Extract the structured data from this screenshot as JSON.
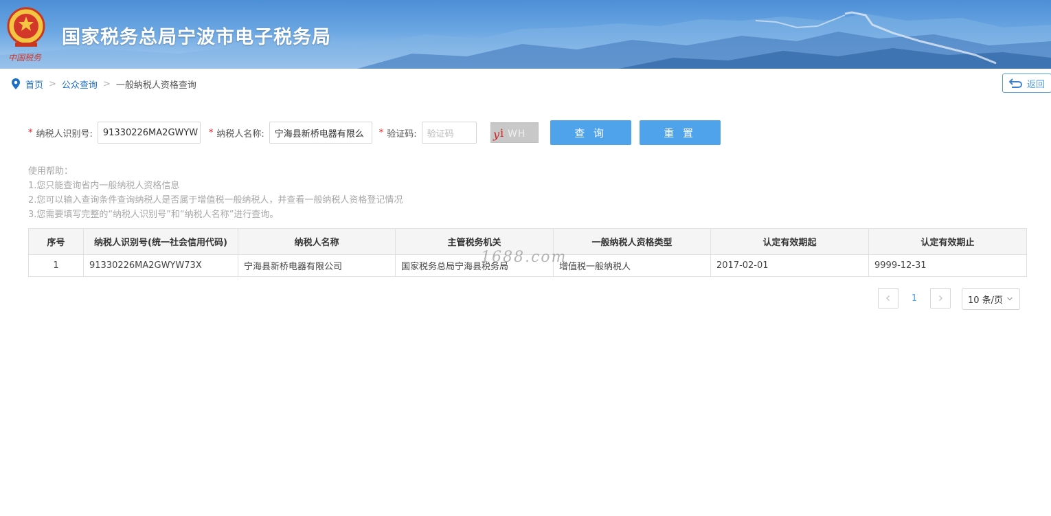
{
  "header": {
    "site_title": "国家税务总局宁波市电子税务局",
    "emblem_caption": "中国税务"
  },
  "breadcrumb": {
    "home": "首页",
    "separator": ">",
    "public_query": "公众查询",
    "current": "一般纳税人资格查询"
  },
  "back_button": {
    "label": "返回"
  },
  "search_form": {
    "taxpayer_id": {
      "label": "纳税人识别号:",
      "value": "91330226MA2GWYW"
    },
    "taxpayer_name": {
      "label": "纳税人名称:",
      "value": "宁海县新桥电器有限么"
    },
    "captcha": {
      "label": "验证码:",
      "placeholder": "验证码",
      "image_text": "yi WH"
    },
    "required_mark": "*",
    "query_button": "查 询",
    "reset_button": "重 置"
  },
  "help": {
    "title": "使用帮助：",
    "lines": [
      "1.您只能查询省内一般纳税人资格信息",
      "2.您可以输入查询条件查询纳税人是否属于增值税一般纳税人，并查看一般纳税人资格登记情况",
      "3.您需要填写完整的“纳税人识别号”和“纳税人名称”进行查询。"
    ]
  },
  "table": {
    "columns": [
      "序号",
      "纳税人识别号(统一社会信用代码)",
      "纳税人名称",
      "主管税务机关",
      "一般纳税人资格类型",
      "认定有效期起",
      "认定有效期止"
    ],
    "rows": [
      [
        "1",
        "91330226MA2GWYW73X",
        "宁海县新桥电器有限公司",
        "国家税务总局宁海县税务局",
        "增值税一般纳税人",
        "2017-02-01",
        "9999-12-31"
      ]
    ]
  },
  "watermark": "1688.com",
  "pagination": {
    "prev_icon": "chevron-left-icon",
    "next_icon": "chevron-right-icon",
    "current_page": "1",
    "page_size": "10 条/页"
  },
  "colors": {
    "accent": "#4ea3ea",
    "link": "#1d6fc4",
    "required": "#e02020",
    "help_text": "#a8a8a8"
  }
}
